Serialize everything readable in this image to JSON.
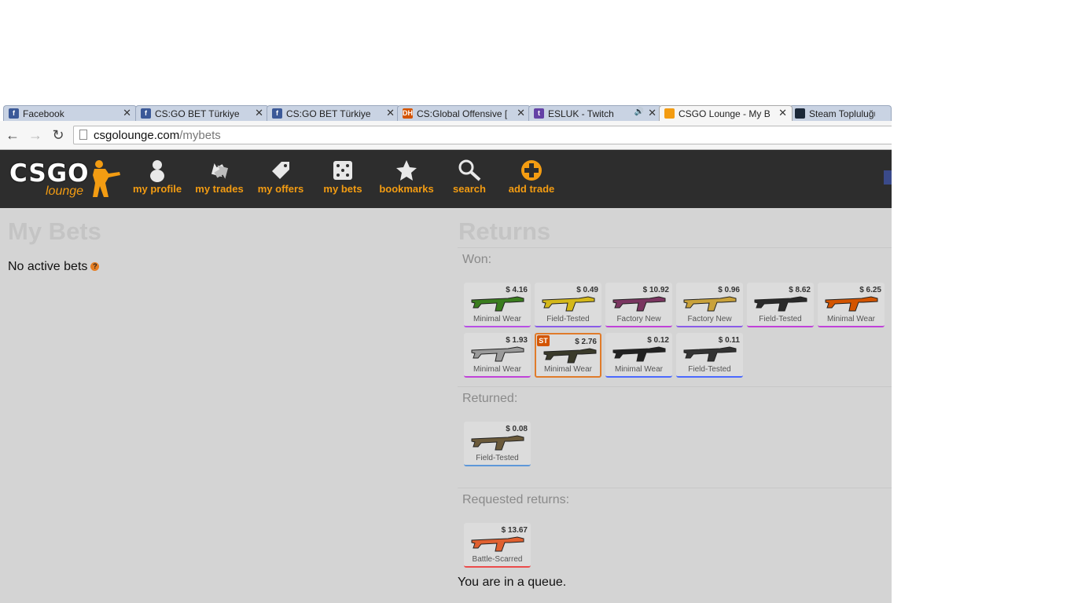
{
  "browser": {
    "tabs": [
      {
        "title": "Facebook",
        "favicon": "facebook-icon",
        "favicon_text": "f",
        "color": "#3b5998"
      },
      {
        "title": "CS:GO BET Türkiye",
        "favicon": "facebook-icon",
        "favicon_text": "f",
        "color": "#3b5998"
      },
      {
        "title": "CS:GO BET Türkiye",
        "favicon": "facebook-icon",
        "favicon_text": "f",
        "color": "#3b5998"
      },
      {
        "title": "CS:Global Offensive [",
        "favicon": "dh-icon",
        "favicon_text": "DH",
        "color": "#d35400"
      },
      {
        "title": "ESLUK - Twitch",
        "favicon": "twitch-icon",
        "favicon_text": "t",
        "color": "#6441a5"
      },
      {
        "title": "CSGO Lounge - My B",
        "favicon": "csgolounge-icon",
        "favicon_text": "",
        "color": "#f39c12"
      },
      {
        "title": "Steam Topluluğu",
        "favicon": "steam-icon",
        "favicon_text": "",
        "color": "#1b2838"
      }
    ],
    "url_host": "csgolounge.com",
    "url_path": "/mybets"
  },
  "site": {
    "logo_main": "CSGO",
    "logo_sub": "lounge",
    "nav": [
      {
        "label": "my profile",
        "icon": "profile-icon"
      },
      {
        "label": "my trades",
        "icon": "trades-icon"
      },
      {
        "label": "my offers",
        "icon": "tag-icon"
      },
      {
        "label": "my bets",
        "icon": "dice-icon"
      },
      {
        "label": "bookmarks",
        "icon": "star-icon"
      },
      {
        "label": "search",
        "icon": "search-icon"
      },
      {
        "label": "add trade",
        "icon": "plus-icon"
      }
    ]
  },
  "mybets": {
    "title": "My Bets",
    "status": "No active bets",
    "help": "?"
  },
  "returns": {
    "title": "Returns",
    "won_label": "Won:",
    "won_items": [
      {
        "price": "$ 4.16",
        "wear": "Minimal Wear",
        "rarity_color": "#b84fe6",
        "gun": "#3a7d1e"
      },
      {
        "price": "$ 0.49",
        "wear": "Field-Tested",
        "rarity_color": "#8a5be8",
        "gun": "#d4b81a"
      },
      {
        "price": "$ 10.92",
        "wear": "Factory New",
        "rarity_color": "#c042d9",
        "gun": "#7a3560"
      },
      {
        "price": "$ 0.96",
        "wear": "Factory New",
        "rarity_color": "#8a5be8",
        "gun": "#c9a23b"
      },
      {
        "price": "$ 8.62",
        "wear": "Field-Tested",
        "rarity_color": "#c042d9",
        "gun": "#2a2a2a"
      },
      {
        "price": "$ 6.25",
        "wear": "Minimal Wear",
        "rarity_color": "#c042d9",
        "gun": "#d35400"
      },
      {
        "price": "$ 1.93",
        "wear": "Minimal Wear",
        "rarity_color": "#c042d9",
        "gun": "#9a9a9a"
      },
      {
        "price": "$ 2.76",
        "wear": "Minimal Wear",
        "rarity_color": "#e07b2a",
        "gun": "#3a3a2a",
        "badge": "ST"
      },
      {
        "price": "$ 0.12",
        "wear": "Minimal Wear",
        "rarity_color": "#4b69ff",
        "gun": "#222222"
      },
      {
        "price": "$ 0.11",
        "wear": "Field-Tested",
        "rarity_color": "#4b69ff",
        "gun": "#333333"
      }
    ],
    "returned_label": "Returned:",
    "returned_items": [
      {
        "price": "$ 0.08",
        "wear": "Field-Tested",
        "rarity_color": "#5e98d9",
        "gun": "#6b5a3a"
      }
    ],
    "requested_label": "Requested returns:",
    "requested_items": [
      {
        "price": "$ 13.67",
        "wear": "Battle-Scarred",
        "rarity_color": "#eb4b4b",
        "gun": "#e06030"
      }
    ],
    "queue_text": "You are in a queue."
  }
}
